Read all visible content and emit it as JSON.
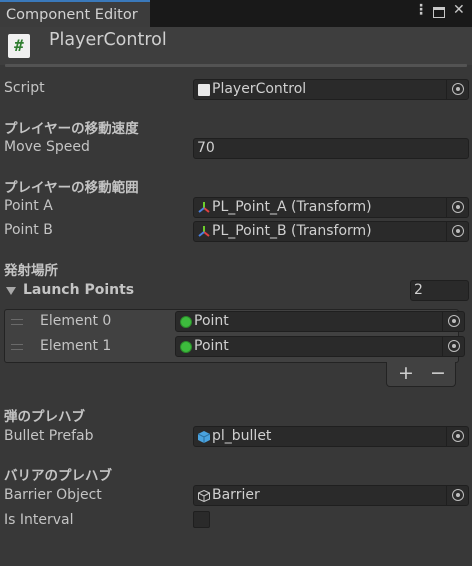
{
  "window": {
    "tab_label": "Component Editor",
    "menu_icon": "kebab-menu-icon",
    "maximize_icon": "maximize-icon",
    "close_icon": "close-icon"
  },
  "component": {
    "icon_glyph": "#",
    "title": "PlayerControl"
  },
  "script": {
    "label": "Script",
    "value": "PlayerControl"
  },
  "section_speed": {
    "header": "プレイヤーの移動速度",
    "label": "Move Speed",
    "value": "70"
  },
  "section_range": {
    "header": "プレイヤーの移動範囲",
    "point_a_label": "Point A",
    "point_a_value": "PL_Point_A (Transform)",
    "point_b_label": "Point B",
    "point_b_value": "PL_Point_B (Transform)"
  },
  "section_launch": {
    "header": "発射場所",
    "list_label": "Launch Points",
    "count": "2",
    "elements": [
      {
        "label": "Element 0",
        "value": "Point"
      },
      {
        "label": "Element 1",
        "value": "Point"
      }
    ],
    "add_label": "+",
    "remove_label": "−"
  },
  "section_bullet": {
    "header": "弾のプレハブ",
    "label": "Bullet Prefab",
    "value": "pl_bullet"
  },
  "section_barrier": {
    "header": "バリアのプレハブ",
    "label": "Barrier Object",
    "value": "Barrier",
    "interval_label": "Is Interval",
    "interval_checked": false
  },
  "colors": {
    "accent": "#3a79bb",
    "background": "#383838",
    "field": "#2a2a2a",
    "green": "#3dbb3d"
  }
}
